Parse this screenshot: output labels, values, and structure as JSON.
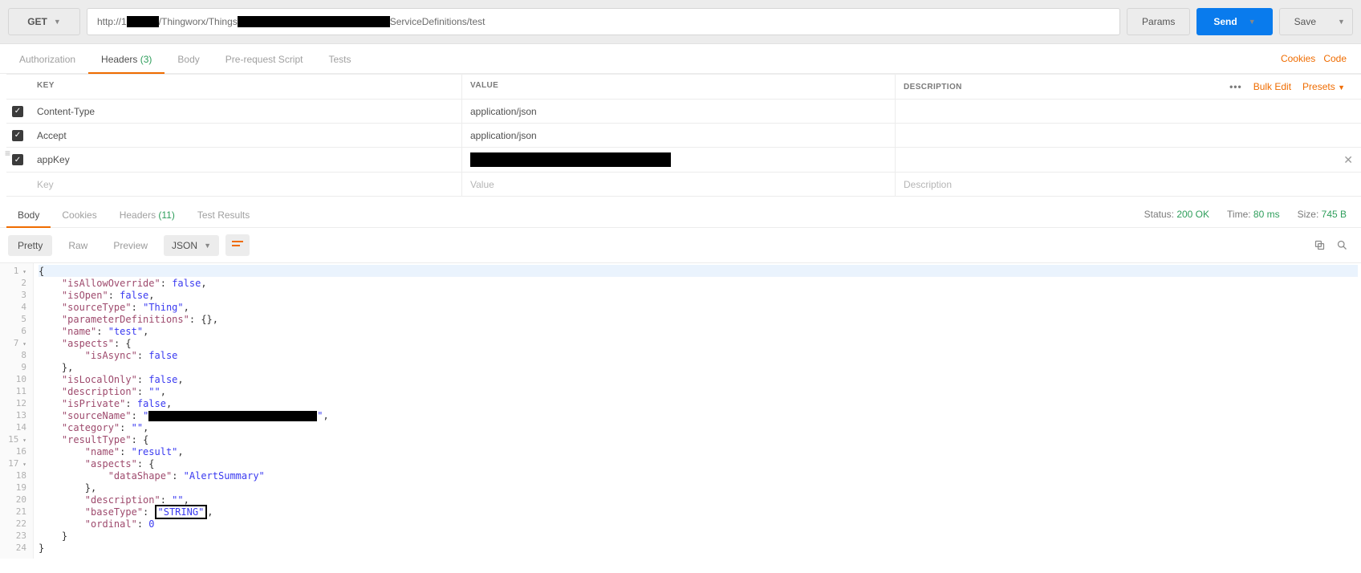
{
  "request": {
    "method": "GET",
    "url_prefix": "http://1",
    "url_middle": "/Thingworx/Things",
    "url_suffix": "ServiceDefinitions/test",
    "params_label": "Params",
    "send_label": "Send",
    "save_label": "Save"
  },
  "req_tabs": {
    "authorization": "Authorization",
    "headers": "Headers",
    "headers_count": "(3)",
    "body": "Body",
    "prerequest": "Pre-request Script",
    "tests": "Tests",
    "cookies_link": "Cookies",
    "code_link": "Code"
  },
  "hdr_table": {
    "col_key": "KEY",
    "col_val": "VALUE",
    "col_desc": "DESCRIPTION",
    "bulk_edit": "Bulk Edit",
    "presets": "Presets",
    "rows": [
      {
        "key": "Content-Type",
        "value": "application/json",
        "desc": ""
      },
      {
        "key": "Accept",
        "value": "application/json",
        "desc": ""
      },
      {
        "key": "appKey",
        "value": "[redacted]",
        "desc": ""
      }
    ],
    "placeholder": {
      "key": "Key",
      "value": "Value",
      "desc": "Description"
    }
  },
  "res_tabs": {
    "body": "Body",
    "cookies": "Cookies",
    "headers": "Headers",
    "headers_count": "(11)",
    "test_results": "Test Results",
    "status_label": "Status:",
    "status_value": "200 OK",
    "time_label": "Time:",
    "time_value": "80 ms",
    "size_label": "Size:",
    "size_value": "745 B"
  },
  "body_toolbar": {
    "pretty": "Pretty",
    "raw": "Raw",
    "preview": "Preview",
    "format": "JSON"
  },
  "code": {
    "lines": [
      "{",
      "    \"isAllowOverride\": false,",
      "    \"isOpen\": false,",
      "    \"sourceType\": \"Thing\",",
      "    \"parameterDefinitions\": {},",
      "    \"name\": \"test\",",
      "    \"aspects\": {",
      "        \"isAsync\": false",
      "    },",
      "    \"isLocalOnly\": false,",
      "    \"description\": \"\",",
      "    \"isPrivate\": false,",
      "    \"sourceName\": \"[redacted]\",",
      "    \"category\": \"\",",
      "    \"resultType\": {",
      "        \"name\": \"result\",",
      "        \"aspects\": {",
      "            \"dataShape\": \"AlertSummary\"",
      "        },",
      "        \"description\": \"\",",
      "        \"baseType\": \"STRING\",",
      "        \"ordinal\": 0",
      "    }",
      "}"
    ],
    "folds": [
      1,
      7,
      15,
      17
    ]
  }
}
